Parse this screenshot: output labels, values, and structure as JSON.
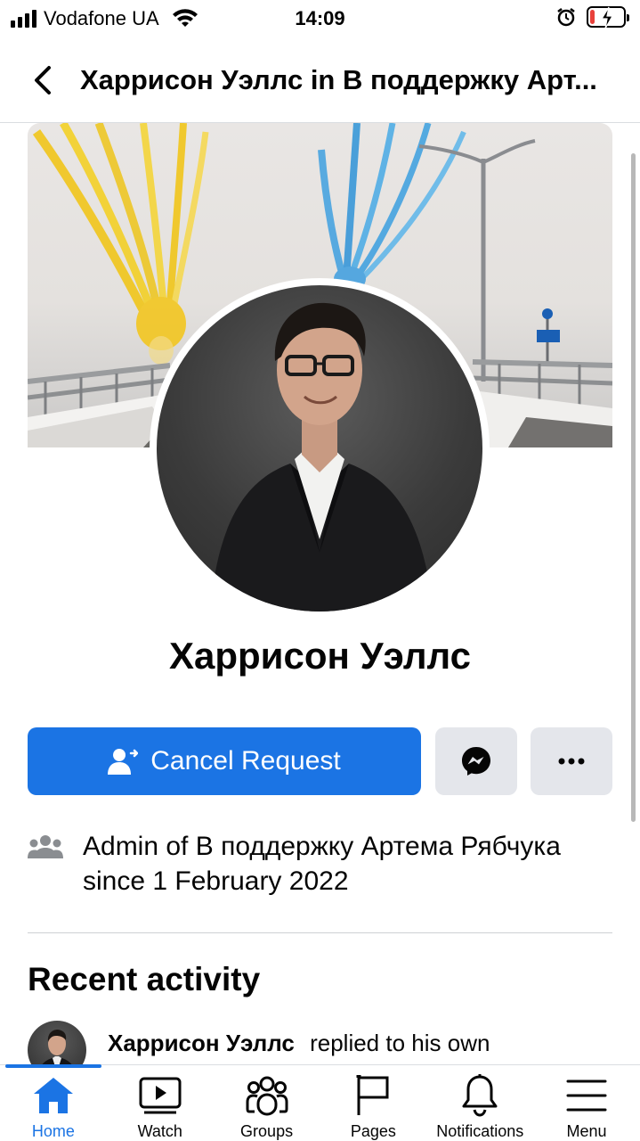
{
  "status_bar": {
    "carrier": "Vodafone UA",
    "time": "14:09",
    "battery_level": 0.15,
    "battery_color": "#e8413b"
  },
  "header": {
    "title": "Харрисон Уэллс in В поддержку Арт..."
  },
  "profile": {
    "name": "Харрисон Уэллс"
  },
  "actions": {
    "cancel_request_label": "Cancel Request",
    "accent_color": "#1b74e4"
  },
  "admin_info": {
    "prefix": "Admin of",
    "group_name": "В поддержку Артема Рябчука",
    "suffix": "since 1 February 2022"
  },
  "recent_activity": {
    "title": "Recent activity",
    "items": [
      {
        "actor": "Харрисон Уэллс",
        "action": "replied to his own"
      }
    ]
  },
  "tabs": [
    {
      "label": "Home",
      "icon": "home-icon",
      "active": true
    },
    {
      "label": "Watch",
      "icon": "watch-icon",
      "active": false
    },
    {
      "label": "Groups",
      "icon": "groups-icon",
      "active": false
    },
    {
      "label": "Pages",
      "icon": "pages-icon",
      "active": false
    },
    {
      "label": "Notifications",
      "icon": "bell-icon",
      "active": false
    },
    {
      "label": "Menu",
      "icon": "menu-icon",
      "active": false
    }
  ]
}
